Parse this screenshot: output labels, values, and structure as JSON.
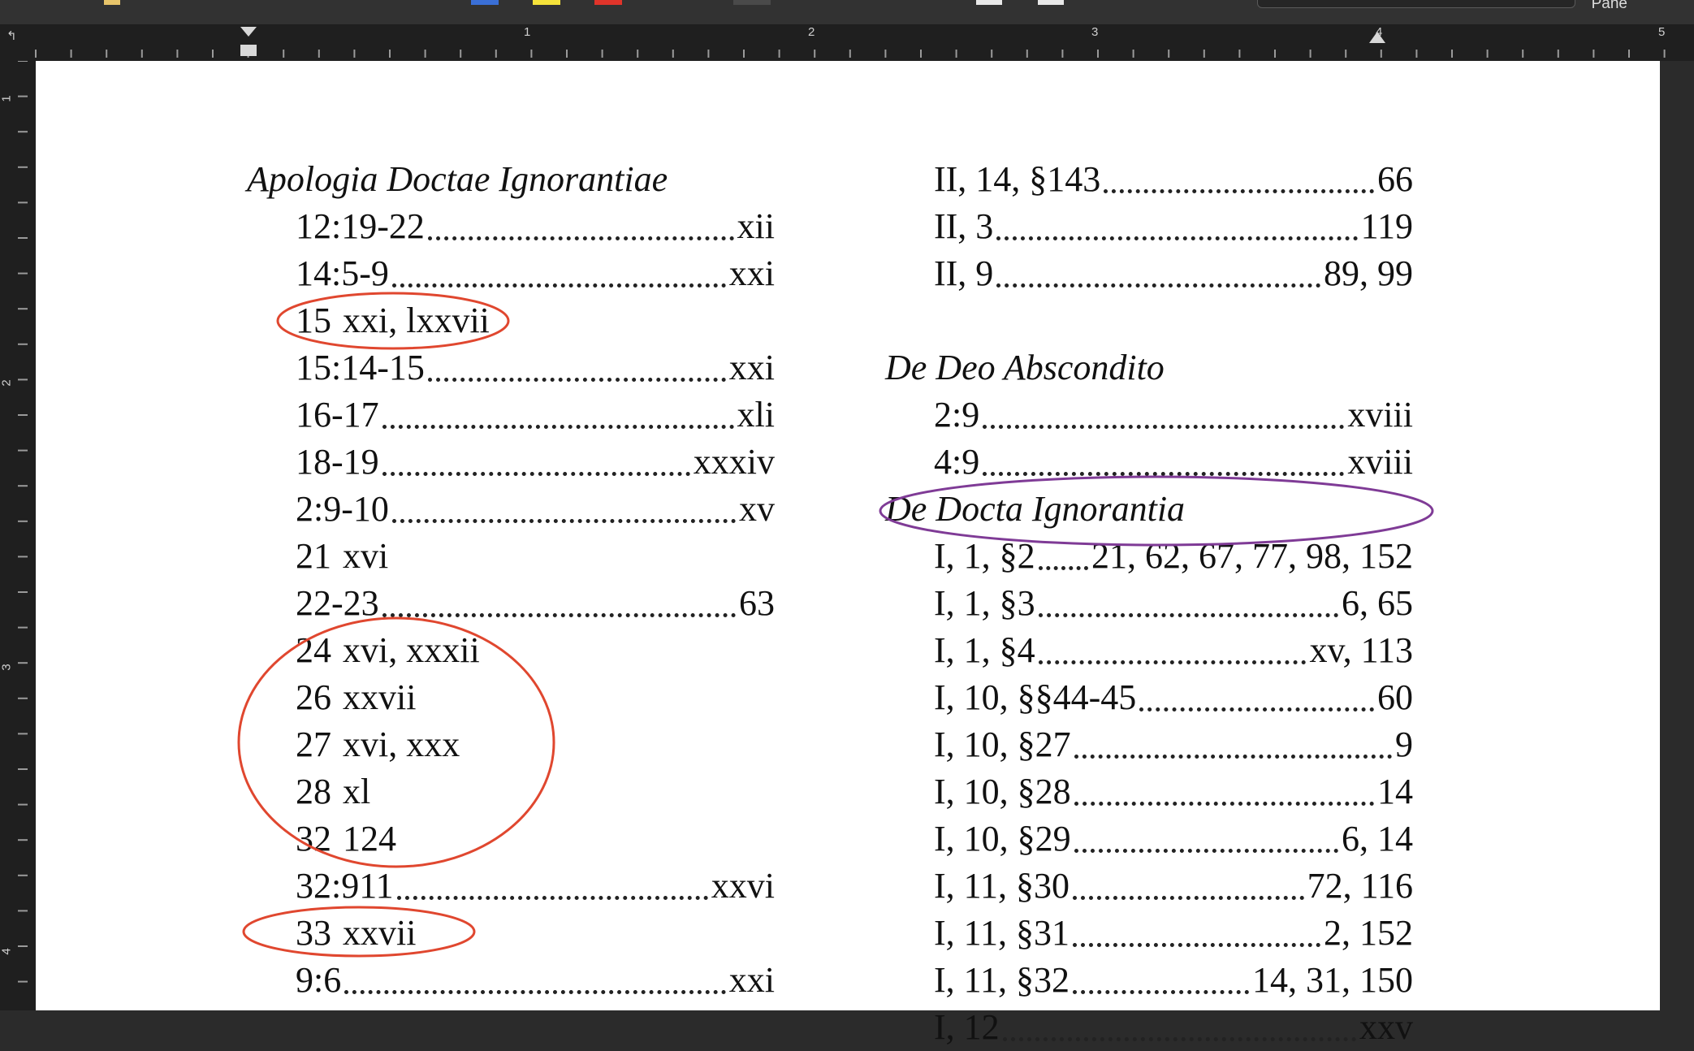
{
  "window": {
    "pane_label": "Pane"
  },
  "ruler": {
    "numbers": [
      "1",
      "2",
      "3",
      "4",
      "5"
    ],
    "vertical_numbers": [
      "1",
      "2",
      "3",
      "4"
    ]
  },
  "left_column": {
    "heading": "Apologia Doctae Ignorantiae",
    "entries": [
      {
        "ref": "12:19-22",
        "pages": "xii",
        "dotted": true
      },
      {
        "ref": "14:5-9",
        "pages": "xxi",
        "dotted": true
      },
      {
        "ref": "15",
        "pages": "xxi, lxxvii",
        "dotted": false
      },
      {
        "ref": "15:14-15",
        "pages": "xxi",
        "dotted": true
      },
      {
        "ref": "16-17",
        "pages": "xli",
        "dotted": true
      },
      {
        "ref": "18-19",
        "pages": "xxxiv",
        "dotted": true
      },
      {
        "ref": "2:9-10",
        "pages": "xv",
        "dotted": true
      },
      {
        "ref": "21",
        "pages": "xvi",
        "dotted": false
      },
      {
        "ref": "22-23",
        "pages": "63",
        "dotted": true
      },
      {
        "ref": "24",
        "pages": "xvi, xxxii",
        "dotted": false
      },
      {
        "ref": "26",
        "pages": "xxvii",
        "dotted": false
      },
      {
        "ref": "27",
        "pages": "xvi, xxx",
        "dotted": false
      },
      {
        "ref": "28",
        "pages": "xl",
        "dotted": false
      },
      {
        "ref": "32",
        "pages": "124",
        "dotted": false
      },
      {
        "ref": "32:911",
        "pages": "xxvi",
        "dotted": true
      },
      {
        "ref": "33",
        "pages": "xxvii",
        "dotted": false
      },
      {
        "ref": "9:6",
        "pages": "xxi",
        "dotted": true
      }
    ]
  },
  "right_column": {
    "entries_top": [
      {
        "ref": "II, 14, §143",
        "pages": "66"
      },
      {
        "ref": "II, 3",
        "pages": "119"
      },
      {
        "ref": "II, 9",
        "pages": "89, 99"
      }
    ],
    "heading_2": "De Deo Abscondito",
    "entries_mid": [
      {
        "ref": "2:9",
        "pages": "xviii"
      },
      {
        "ref": "4:9",
        "pages": "xviii"
      }
    ],
    "heading_3": "De Docta Ignorantia",
    "entries_bottom": [
      {
        "ref": "I, 1, §2",
        "pages": "21, 62, 67, 77, 98, 152"
      },
      {
        "ref": "I, 1, §3",
        "pages": "6, 65"
      },
      {
        "ref": "I, 1, §4",
        "pages": "xv, 113"
      },
      {
        "ref": "I, 10, §§44-45",
        "pages": "60"
      },
      {
        "ref": "I, 10, §27",
        "pages": "9"
      },
      {
        "ref": "I, 10, §28",
        "pages": "14"
      },
      {
        "ref": "I, 10, §29",
        "pages": "6, 14"
      },
      {
        "ref": "I, 11, §30",
        "pages": "72, 116"
      },
      {
        "ref": "I, 11, §31",
        "pages": "2, 152"
      },
      {
        "ref": "I, 11, §32",
        "pages": "14, 31, 150"
      },
      {
        "ref": "I, 12",
        "pages": "xxv"
      }
    ]
  },
  "annotations": {
    "red_color": "#e0472f",
    "purple_color": "#7f3b96",
    "red_circles": [
      "15 xxi, lxxvii",
      "24 – 32 block",
      "33 xxvii"
    ],
    "purple_circle": "I, 1, §2 . 21, 62, 67, 77, 98, 152"
  }
}
